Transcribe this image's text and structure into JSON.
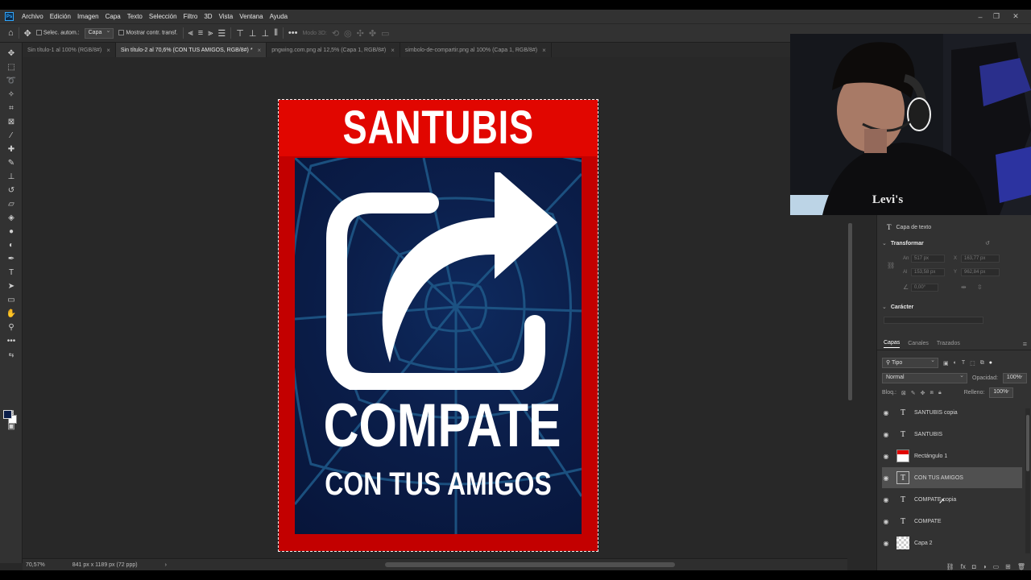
{
  "app": {
    "logo": "Ps",
    "menu": [
      "Archivo",
      "Edición",
      "Imagen",
      "Capa",
      "Texto",
      "Selección",
      "Filtro",
      "3D",
      "Vista",
      "Ventana",
      "Ayuda"
    ]
  },
  "options": {
    "auto_select_label": "Selec. autom.:",
    "layer_select_value": "Capa",
    "transform_label": "Mostrar contr. transf.",
    "mode3d_label": "Modo 3D:"
  },
  "tabs": [
    {
      "label": "Sin título-1 al 100% (RGB/8#)",
      "active": false
    },
    {
      "label": "Sin título-2 al 70,6% (CON TUS AMIGOS, RGB/8#) *",
      "active": true
    },
    {
      "label": "pngwing.com.png al 12,5% (Capa 1, RGB/8#)",
      "active": false
    },
    {
      "label": "simbolo-de-compartir.png al 100% (Capa 1, RGB/8#)",
      "active": false
    }
  ],
  "artboard": {
    "title": "SANTUBIS",
    "main_text": "COMPATE",
    "sub_text": "CON TUS AMIGOS"
  },
  "status": {
    "zoom": "70,57%",
    "doc_info": "841 px x 1189 px (72 ppp)",
    "arrow": "›"
  },
  "properties": {
    "layer_kind": "Capa de texto",
    "transform_label": "Transformar",
    "w_label": "An",
    "w_value": "517 px",
    "x_label": "X",
    "x_value": "163,77 px",
    "h_label": "Al",
    "h_value": "153,58 px",
    "y_label": "Y",
    "y_value": "962,84 px",
    "angle_value": "0,00°",
    "character_label": "Carácter"
  },
  "layers_panel": {
    "tabs": [
      "Capas",
      "Canales",
      "Trazados"
    ],
    "filter_value": "Tipo",
    "blend_mode": "Normal",
    "opacity_label": "Opacidad:",
    "opacity_value": "100%",
    "lock_label": "Bloq.:",
    "fill_label": "Relleno:",
    "fill_value": "100%",
    "layers": [
      {
        "name": "SANTUBIS copia",
        "type": "text"
      },
      {
        "name": "SANTUBIS",
        "type": "text"
      },
      {
        "name": "Rectángulo 1",
        "type": "shape"
      },
      {
        "name": "CON TUS AMIGOS",
        "type": "text",
        "selected": true
      },
      {
        "name": "COMPATE copia",
        "type": "text"
      },
      {
        "name": "COMPATE",
        "type": "text"
      },
      {
        "name": "Capa 2",
        "type": "raster"
      }
    ]
  },
  "colors": {
    "accent_red": "#e10600",
    "panel_dark": "#0b1e4a",
    "foreground_swatch": "#0b1e4a",
    "background_swatch": "#ffffff"
  },
  "webcam": {
    "shirt_text": "Levi's"
  }
}
